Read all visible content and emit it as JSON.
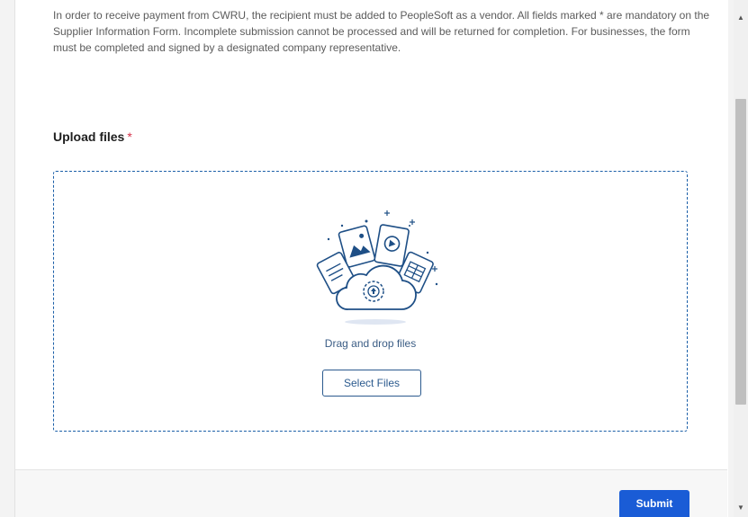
{
  "intro": {
    "text": "In order to receive payment from CWRU, the recipient must be added to PeopleSoft as a vendor. All fields marked * are mandatory on the Supplier Information Form. Incomplete submission cannot be processed and will be returned for completion. For businesses, the form must be completed and signed by a designated company representative."
  },
  "upload": {
    "label": "Upload files",
    "required_marker": "*",
    "drag_text": "Drag and drop files",
    "select_button": "Select Files",
    "illustration_icon": "cloud-upload-icon"
  },
  "footer": {
    "submit_label": "Submit"
  },
  "colors": {
    "accent": "#1a5cd6",
    "dropzone_border": "#1b5fa8",
    "required": "#d6324a"
  }
}
